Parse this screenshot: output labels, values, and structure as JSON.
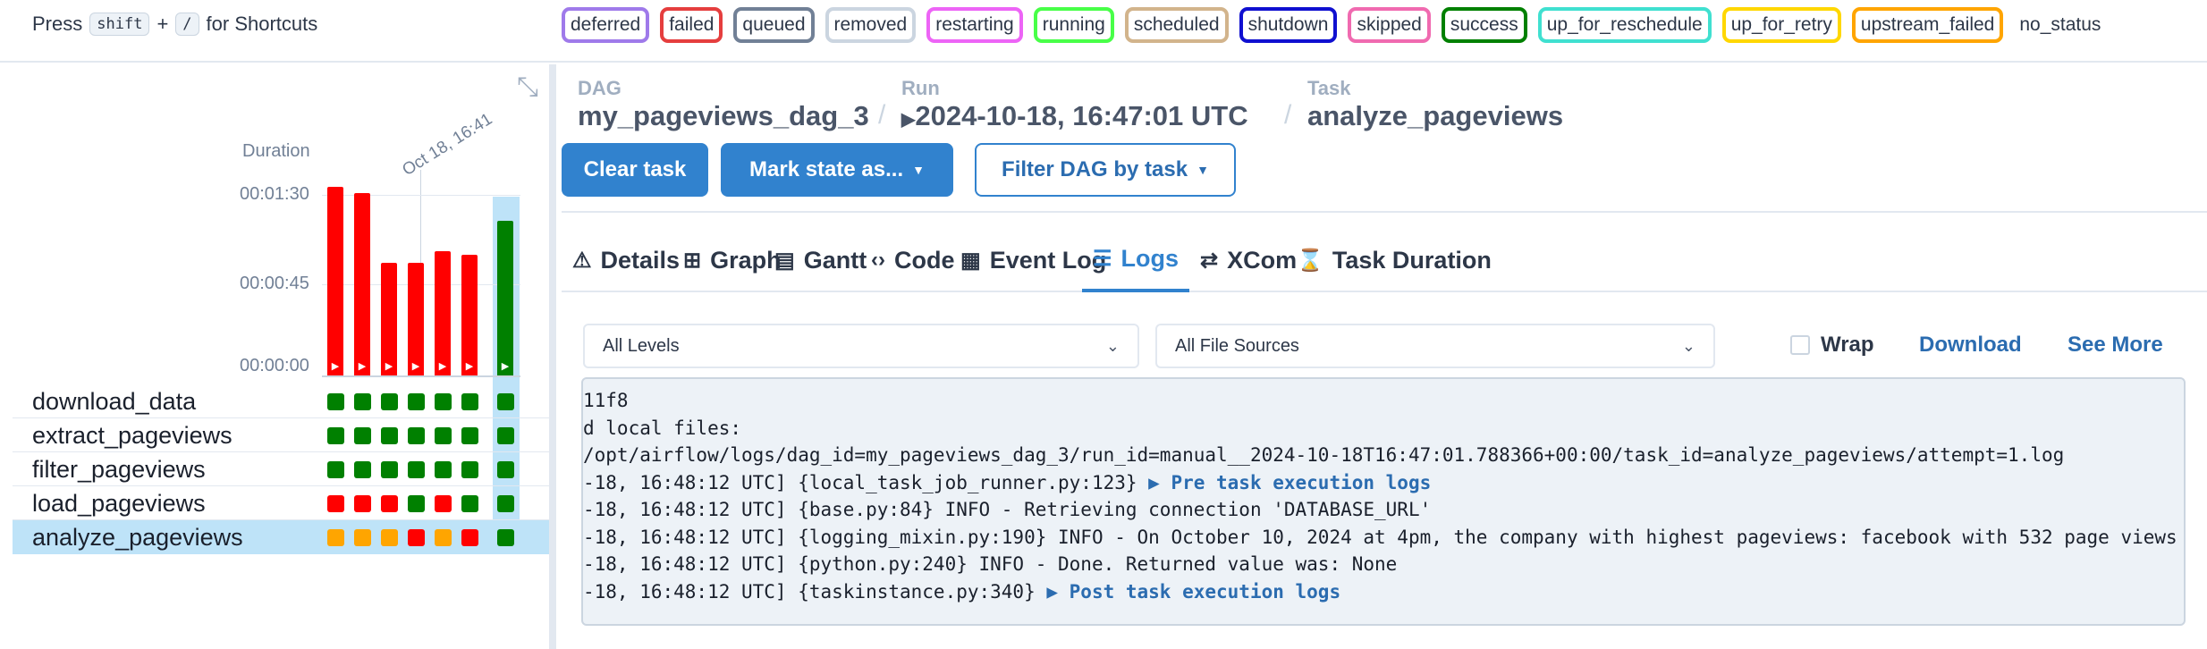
{
  "header": {
    "shortcut_prefix": "Press",
    "shortcut_key1": "shift",
    "shortcut_plus": "+",
    "shortcut_key2": "/",
    "shortcut_suffix": "for Shortcuts"
  },
  "states": [
    {
      "label": "deferred",
      "color": "#9f7aea"
    },
    {
      "label": "failed",
      "color": "#e53e3e"
    },
    {
      "label": "queued",
      "color": "#718096"
    },
    {
      "label": "removed",
      "color": "#cbd5e0"
    },
    {
      "label": "restarting",
      "color": "#ed64f6"
    },
    {
      "label": "running",
      "color": "#48ff48"
    },
    {
      "label": "scheduled",
      "color": "#d2b48c"
    },
    {
      "label": "shutdown",
      "color": "#1010d0"
    },
    {
      "label": "skipped",
      "color": "#f06ab0"
    },
    {
      "label": "success",
      "color": "#008000"
    },
    {
      "label": "up_for_reschedule",
      "color": "#40e0d0"
    },
    {
      "label": "up_for_retry",
      "color": "#ffd700"
    },
    {
      "label": "upstream_failed",
      "color": "#ffa500"
    },
    {
      "label": "no_status",
      "color": ""
    }
  ],
  "grid": {
    "duration_label": "Duration",
    "run_date_label": "Oct 18, 16:41",
    "y_ticks": [
      "00:01:30",
      "00:00:45",
      "00:00:00"
    ],
    "chart_data": {
      "type": "bar",
      "ylabel": "Duration",
      "ylim_seconds": [
        0,
        90
      ],
      "values_seconds": [
        94,
        91,
        56,
        56,
        62,
        60,
        77
      ],
      "states": [
        "failed",
        "failed",
        "failed",
        "failed",
        "failed",
        "failed",
        "success"
      ]
    },
    "tasks": [
      {
        "name": "download_data",
        "statuses": [
          "success",
          "success",
          "success",
          "success",
          "success",
          "success",
          "success"
        ]
      },
      {
        "name": "extract_pageviews",
        "statuses": [
          "success",
          "success",
          "success",
          "success",
          "success",
          "success",
          "success"
        ]
      },
      {
        "name": "filter_pageviews",
        "statuses": [
          "success",
          "success",
          "success",
          "success",
          "success",
          "success",
          "success"
        ]
      },
      {
        "name": "load_pageviews",
        "statuses": [
          "failed",
          "failed",
          "failed",
          "success",
          "failed",
          "success",
          "success"
        ]
      },
      {
        "name": "analyze_pageviews",
        "statuses": [
          "upstream_failed",
          "upstream_failed",
          "upstream_failed",
          "failed",
          "upstream_failed",
          "failed",
          "success"
        ]
      }
    ]
  },
  "breadcrumb": {
    "dag_label": "DAG",
    "dag_value": "my_pageviews_dag_3",
    "run_label": "Run",
    "run_value": "2024-10-18, 16:47:01 UTC",
    "task_label": "Task",
    "task_value": "analyze_pageviews",
    "separator": "/"
  },
  "actions": {
    "clear_task": "Clear task",
    "mark_state": "Mark state as...",
    "filter_dag": "Filter DAG by task"
  },
  "tabs": [
    {
      "label": "Details",
      "icon": "warning-icon"
    },
    {
      "label": "Graph",
      "icon": "graph-icon"
    },
    {
      "label": "Gantt",
      "icon": "gantt-icon"
    },
    {
      "label": "Code",
      "icon": "code-icon"
    },
    {
      "label": "Event Log",
      "icon": "calendar-icon"
    },
    {
      "label": "Logs",
      "icon": "list-icon"
    },
    {
      "label": "XCom",
      "icon": "exchange-icon"
    },
    {
      "label": "Task Duration",
      "icon": "hourglass-icon"
    }
  ],
  "logs": {
    "level_select": "All Levels",
    "source_select": "All File Sources",
    "wrap_label": "Wrap",
    "download_label": "Download",
    "see_more_label": "See More",
    "lines": [
      {
        "text": "11f8",
        "link": ""
      },
      {
        "text": "d local files:",
        "link": ""
      },
      {
        "text": "/opt/airflow/logs/dag_id=my_pageviews_dag_3/run_id=manual__2024-10-18T16:47:01.788366+00:00/task_id=analyze_pageviews/attempt=1.log",
        "link": ""
      },
      {
        "text": "-18, 16:48:12 UTC] {local_task_job_runner.py:123} ",
        "link": "▶ Pre task execution logs"
      },
      {
        "text": "-18, 16:48:12 UTC] {base.py:84} INFO - Retrieving connection 'DATABASE_URL'",
        "link": ""
      },
      {
        "text": "-18, 16:48:12 UTC] {logging_mixin.py:190} INFO - On October 10, 2024 at 4pm, the company with highest pageviews: facebook with 532 page views",
        "link": ""
      },
      {
        "text": "-18, 16:48:12 UTC] {python.py:240} INFO - Done. Returned value was: None",
        "link": ""
      },
      {
        "text": "-18, 16:48:12 UTC] {taskinstance.py:340} ",
        "link": "▶ Post task execution logs"
      }
    ]
  }
}
